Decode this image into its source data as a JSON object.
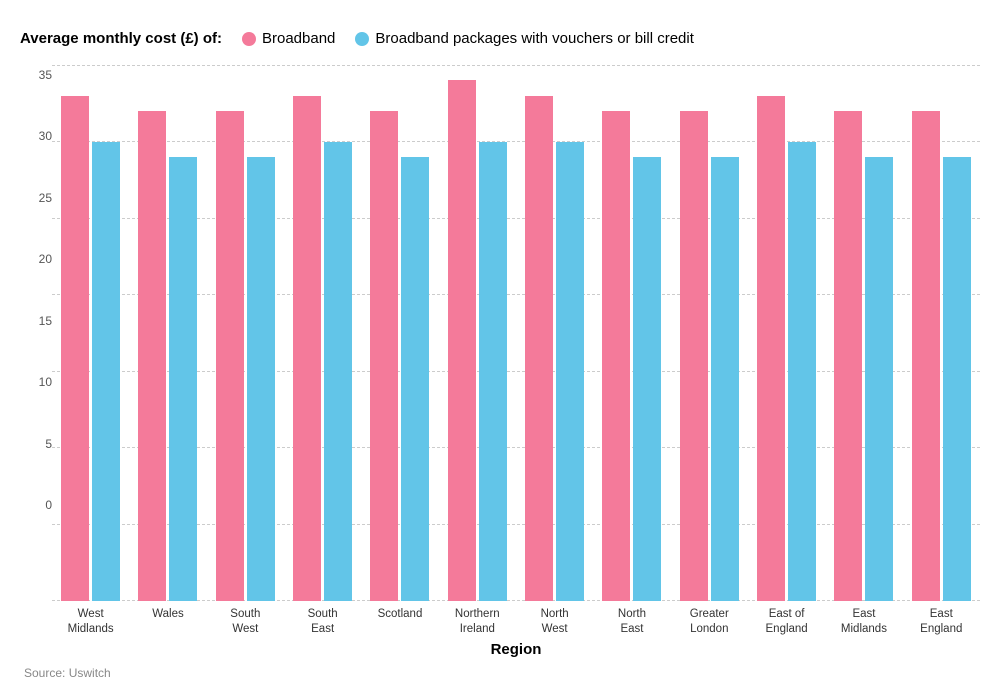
{
  "title": "Average monthly cost (£) of:",
  "legend": {
    "broadband_label": "Broadband",
    "broadband_with_vouchers_label": "Broadband packages with vouchers or bill credit",
    "broadband_color": "#f47a9a",
    "broadband_vouchers_color": "#62c5e8"
  },
  "y_axis": {
    "labels": [
      "0",
      "5",
      "10",
      "15",
      "20",
      "25",
      "30",
      "35"
    ]
  },
  "x_axis_title": "Region",
  "source": "Source: Uswitch",
  "bars": [
    {
      "region": "West\nMidlands",
      "broadband": 33,
      "vouchers": 30
    },
    {
      "region": "Wales",
      "broadband": 32,
      "vouchers": 29
    },
    {
      "region": "South\nWest",
      "broadband": 32,
      "vouchers": 29
    },
    {
      "region": "South\nEast",
      "broadband": 33,
      "vouchers": 30
    },
    {
      "region": "Scotland",
      "broadband": 32,
      "vouchers": 29
    },
    {
      "region": "Northern\nIreland",
      "broadband": 34,
      "vouchers": 30
    },
    {
      "region": "North\nWest",
      "broadband": 33,
      "vouchers": 30
    },
    {
      "region": "North\nEast",
      "broadband": 32,
      "vouchers": 29
    },
    {
      "region": "Greater\nLondon",
      "broadband": 32,
      "vouchers": 29
    },
    {
      "region": "East of\nEngland",
      "broadband": 33,
      "vouchers": 30
    },
    {
      "region": "East\nMidlands",
      "broadband": 32,
      "vouchers": 29
    },
    {
      "region": "East\nEngland",
      "broadband": 32,
      "vouchers": 29
    }
  ],
  "y_max": 35
}
